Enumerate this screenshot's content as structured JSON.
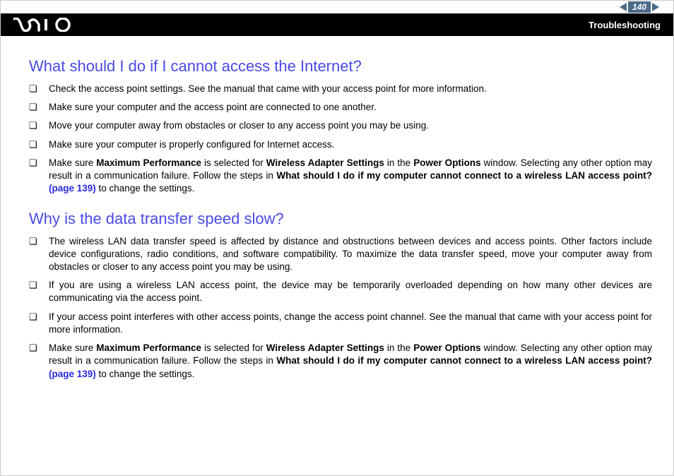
{
  "header": {
    "page_number": "140",
    "section": "Troubleshooting"
  },
  "section1": {
    "heading": "What should I do if I cannot access the Internet?",
    "items": {
      "i1": "Check the access point settings. See the manual that came with your access point for more information.",
      "i2": "Make sure your computer and the access point are connected to one another.",
      "i3": "Move your computer away from obstacles or closer to any access point you may be using.",
      "i4": "Make sure your computer is properly configured for Internet access.",
      "i5a": "Make sure ",
      "i5b": "Maximum Performance",
      "i5c": " is selected for ",
      "i5d": "Wireless Adapter Settings",
      "i5e": " in the ",
      "i5f": "Power Options",
      "i5g": " window. Selecting any other option may result in a communication failure. Follow the steps in ",
      "i5h": "What should I do if my computer cannot connect to a wireless LAN access point? ",
      "i5link": "(page 139)",
      "i5i": " to change the settings."
    }
  },
  "section2": {
    "heading": "Why is the data transfer speed slow?",
    "items": {
      "i1": "The wireless LAN data transfer speed is affected by distance and obstructions between devices and access points. Other factors include device configurations, radio conditions, and software compatibility. To maximize the data transfer speed, move your computer away from obstacles or closer to any access point you may be using.",
      "i2": "If you are using a wireless LAN access point, the device may be temporarily overloaded depending on how many other devices are communicating via the access point.",
      "i3": "If your access point interferes with other access points, change the access point channel. See the manual that came with your access point for more information.",
      "i4a": "Make sure ",
      "i4b": "Maximum Performance",
      "i4c": " is selected for ",
      "i4d": "Wireless Adapter Settings",
      "i4e": " in the ",
      "i4f": "Power Options",
      "i4g": " window. Selecting any other option may result in a communication failure. Follow the steps in ",
      "i4h": "What should I do if my computer cannot connect to a wireless LAN access point? ",
      "i4link": "(page 139)",
      "i4i": " to change the settings."
    }
  }
}
